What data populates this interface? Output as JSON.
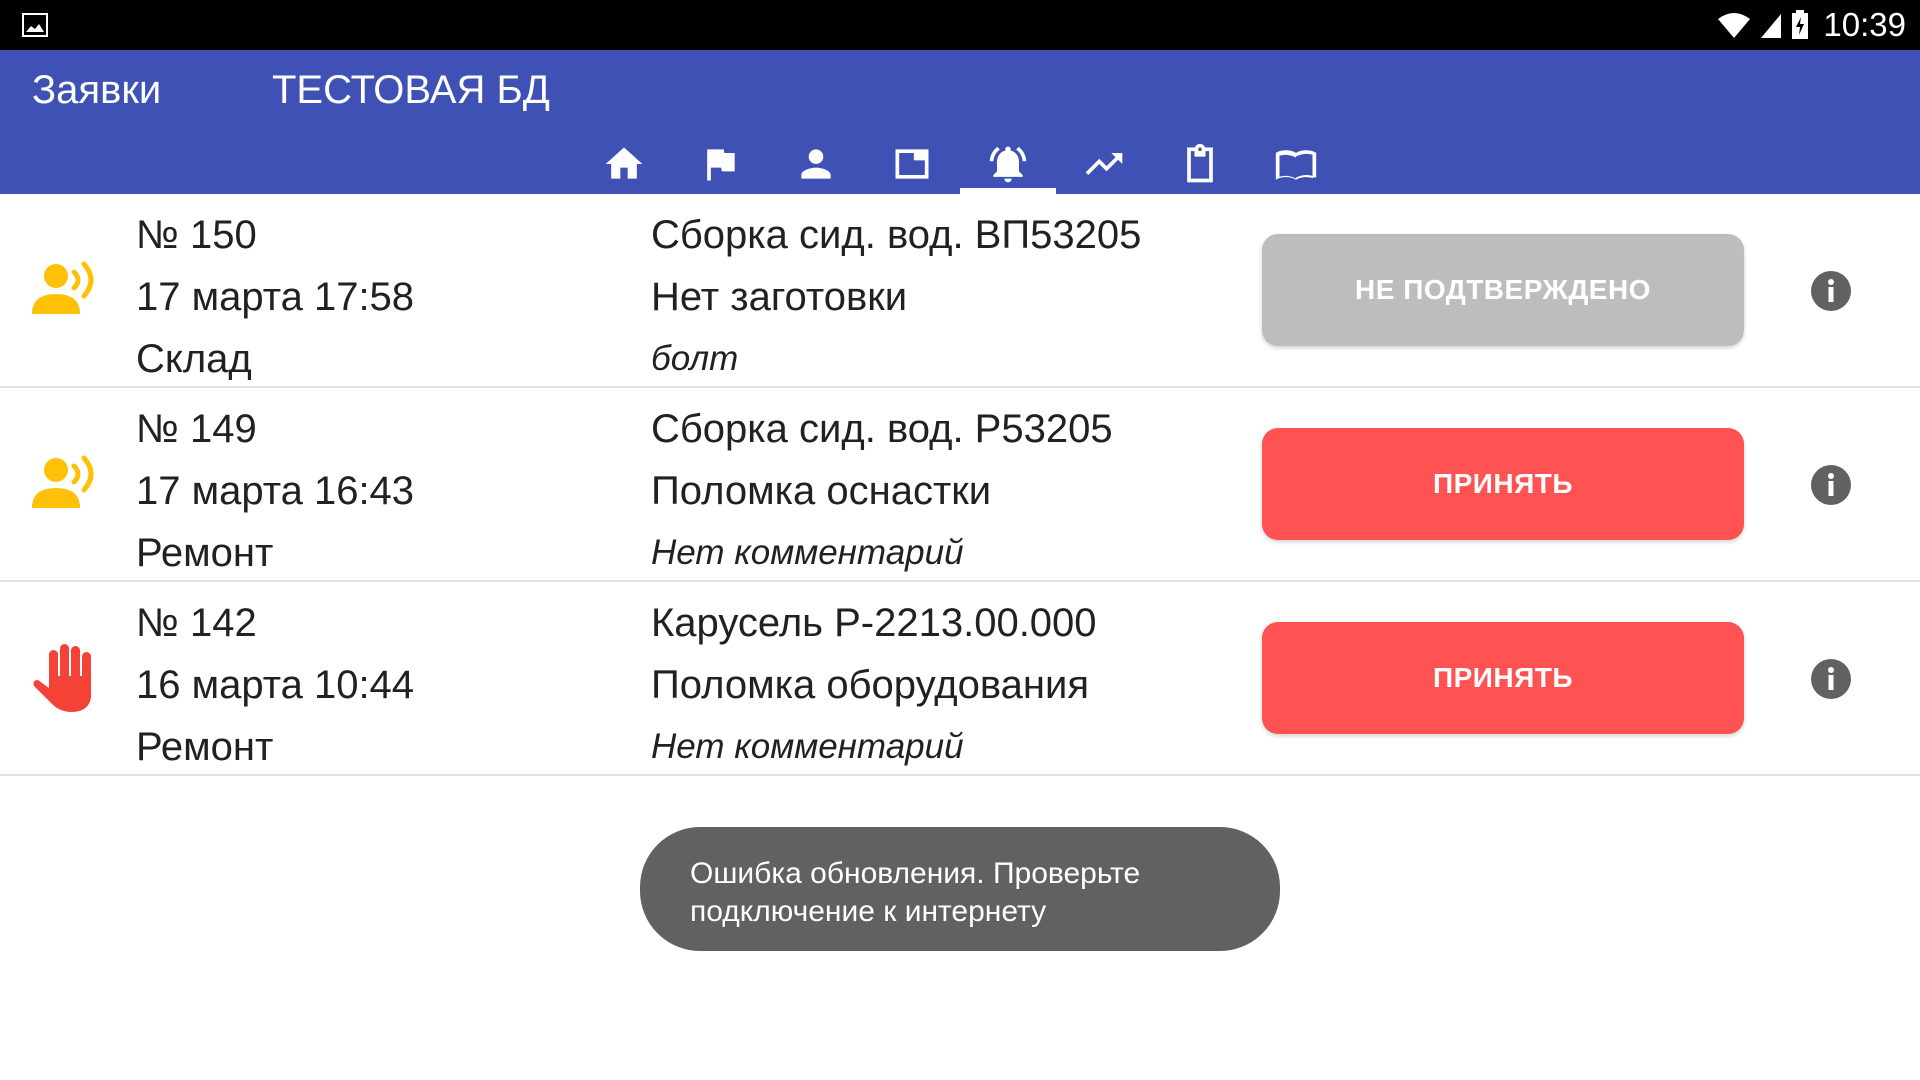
{
  "status_bar": {
    "time": "10:39",
    "icons": [
      "image-icon",
      "wifi-icon",
      "signal-icon",
      "battery-charging-icon"
    ]
  },
  "app_bar": {
    "title": "Заявки",
    "subtitle": "ТЕСТОВАЯ БД",
    "tabs": [
      {
        "icon": "home-icon",
        "active": false
      },
      {
        "icon": "flag-icon",
        "active": false
      },
      {
        "icon": "person-icon",
        "active": false
      },
      {
        "icon": "window-icon",
        "active": false
      },
      {
        "icon": "bell-ringing-icon",
        "active": true
      },
      {
        "icon": "trending-up-icon",
        "active": false
      },
      {
        "icon": "clipboard-icon",
        "active": false
      },
      {
        "icon": "book-icon",
        "active": false
      }
    ]
  },
  "requests": [
    {
      "icon": "person-speaking-icon",
      "number": "№ 150",
      "datetime": "17 марта 17:58",
      "department": "Склад",
      "title": "Сборка сид. вод. ВП53205",
      "reason": "Нет заготовки",
      "comment": "болт",
      "action_label": "НЕ ПОДТВЕРЖДЕНО",
      "action_state": "unconfirmed"
    },
    {
      "icon": "person-speaking-icon",
      "number": "№ 149",
      "datetime": "17 марта 16:43",
      "department": "Ремонт",
      "title": "Сборка сид. вод. Р53205",
      "reason": "Поломка оснастки",
      "comment": "Нет комментарий",
      "action_label": "ПРИНЯТЬ",
      "action_state": "accept"
    },
    {
      "icon": "hand-stop-icon",
      "number": "№ 142",
      "datetime": "16 марта 10:44",
      "department": "Ремонт",
      "title": "Карусель Р-2213.00.000",
      "reason": "Поломка оборудования",
      "comment": "Нет комментарий",
      "action_label": "ПРИНЯТЬ",
      "action_state": "accept"
    }
  ],
  "toast": {
    "line1": "Ошибка обновления. Проверьте",
    "line2": "подключение к интернету"
  },
  "colors": {
    "app_bar": "#3f51b5",
    "accept_button": "#ff5252",
    "unconfirmed_button": "#bdbdbd",
    "alert_yellow": "#ffc107",
    "alert_red": "#f44336",
    "info_gray": "#616161",
    "toast_bg": "#616161"
  }
}
